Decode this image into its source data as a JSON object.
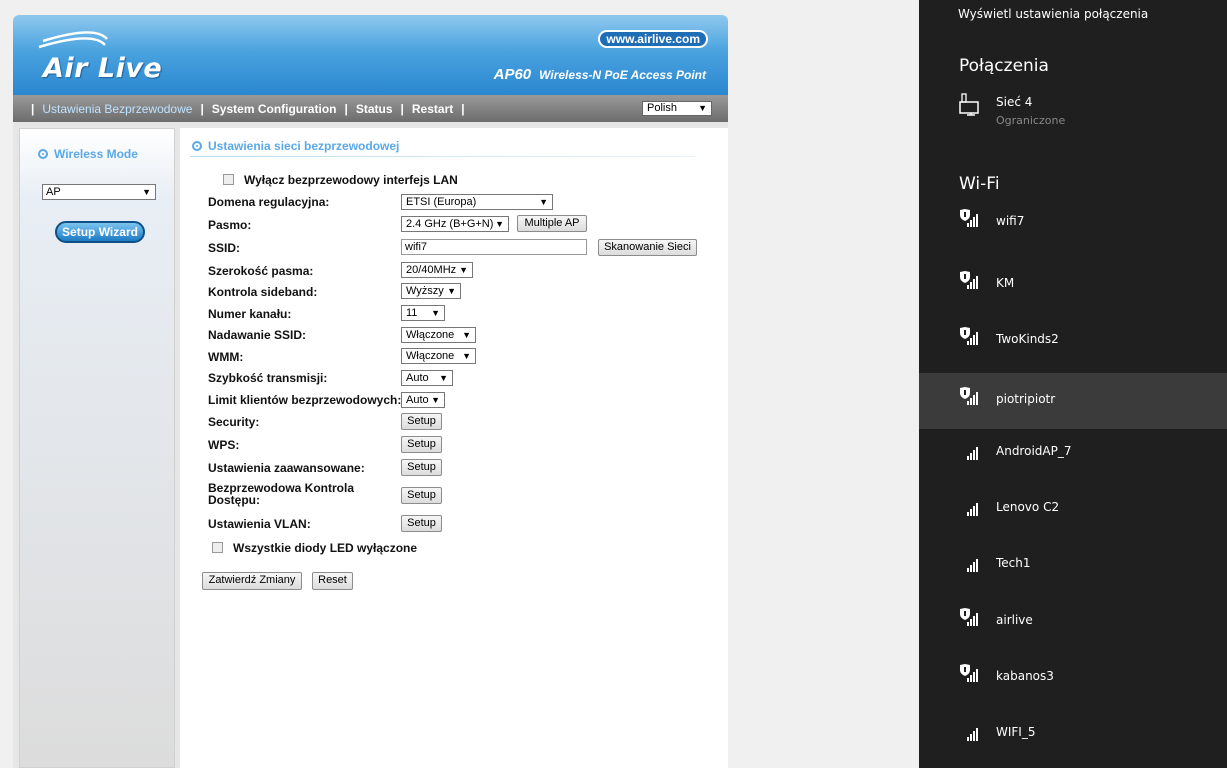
{
  "router": {
    "logo_text": "Air Live",
    "url": "www.airlive.com",
    "model_code": "AP60",
    "model_desc": "Wireless-N PoE Access Point",
    "nav": [
      "Ustawienia Bezprzewodowe",
      "System Configuration",
      "Status",
      "Restart"
    ],
    "language": "Polish",
    "sidebar": {
      "title": "Wireless Mode",
      "mode": "AP",
      "wizard": "Setup Wizard"
    },
    "section_title": "Ustawienia sieci bezprzewodowej",
    "disable_lan_label": "Wyłącz bezprzewodowy interfejs LAN",
    "fields": {
      "domain_label": "Domena regulacyjna:",
      "domain_value": "ETSI (Europa)",
      "band_label": "Pasmo:",
      "band_value": "2.4 GHz (B+G+N)",
      "multiple_ap": "Multiple AP",
      "ssid_label": "SSID:",
      "ssid_value": "wifi7",
      "scan": "Skanowanie Sieci",
      "bandwidth_label": "Szerokość pasma:",
      "bandwidth_value": "20/40MHz",
      "sideband_label": "Kontrola sideband:",
      "sideband_value": "Wyższy",
      "channel_label": "Numer kanału:",
      "channel_value": "11",
      "broadcast_label": "Nadawanie SSID:",
      "broadcast_value": "Włączone",
      "wmm_label": "WMM:",
      "wmm_value": "Włączone",
      "rate_label": "Szybkość transmisji:",
      "rate_value": "Auto",
      "limit_label": "Limit klientów bezprzewodowych:",
      "limit_value": "Auto",
      "security_label": "Security:",
      "wps_label": "WPS:",
      "advanced_label": "Ustawienia zaawansowane:",
      "acl_label_1": "Bezprzewodowa Kontrola",
      "acl_label_2": "Dostępu:",
      "vlan_label": "Ustawienia VLAN:",
      "setup": "Setup"
    },
    "leds_label": "Wszystkie diody LED wyłączone",
    "apply": "Zatwierdź Zmiany",
    "reset": "Reset"
  },
  "network_panel": {
    "top_link": "Wyświetl ustawienia połączenia",
    "connections_title": "Połączenia",
    "ethernet_name": "Sieć  4",
    "ethernet_status": "Ograniczone",
    "wifi_title": "Wi-Fi",
    "networks": [
      "wifi7",
      "KM",
      "TwoKinds2",
      "piotripiotr",
      "AndroidAP_7",
      "Lenovo C2",
      "Tech1",
      "airlive",
      "kabanos3",
      "WIFI_5"
    ],
    "highlighted": "piotripiotr"
  }
}
